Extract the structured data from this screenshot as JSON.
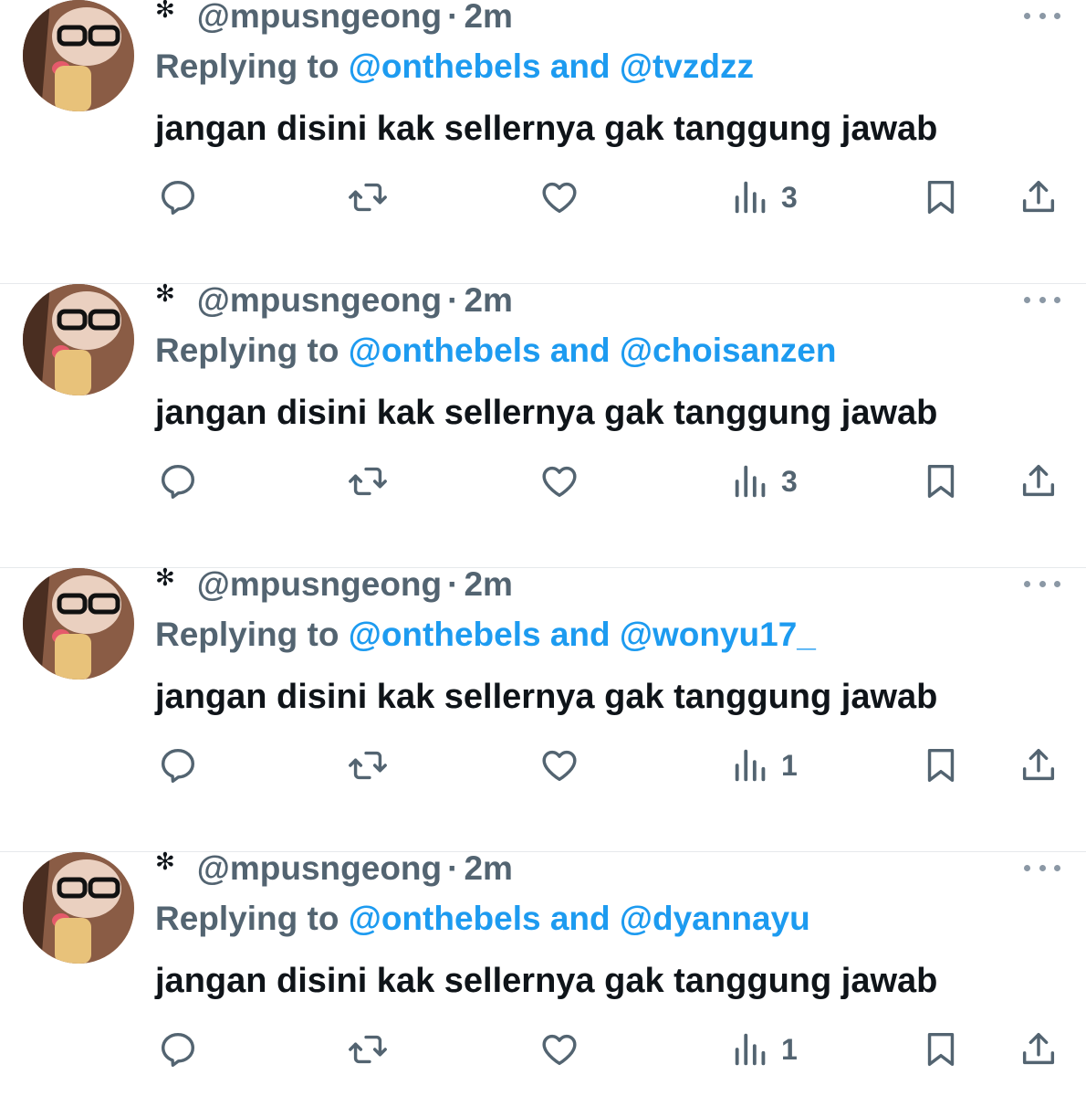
{
  "tweets": [
    {
      "handle": "@mpusngeong",
      "dot": "·",
      "time": "2m",
      "replying_prefix": "Replying to",
      "reply_user1": "@onthebels",
      "reply_and": "and",
      "reply_user2": "@tvzdzz",
      "text": "jangan disini kak sellernya gak tanggung jawab",
      "views": "3"
    },
    {
      "handle": "@mpusngeong",
      "dot": "·",
      "time": "2m",
      "replying_prefix": "Replying to",
      "reply_user1": "@onthebels",
      "reply_and": "and",
      "reply_user2": "@choisanzen",
      "text": "jangan disini kak sellernya gak tanggung jawab",
      "views": "3"
    },
    {
      "handle": "@mpusngeong",
      "dot": "·",
      "time": "2m",
      "replying_prefix": "Replying to",
      "reply_user1": "@onthebels",
      "reply_and": "and",
      "reply_user2": "@wonyu17_",
      "text": "jangan disini kak sellernya gak tanggung jawab",
      "views": "1"
    },
    {
      "handle": "@mpusngeong",
      "dot": "·",
      "time": "2m",
      "replying_prefix": "Replying to",
      "reply_user1": "@onthebels",
      "reply_and": "and",
      "reply_user2": "@dyannayu",
      "text": "jangan disini kak sellernya gak tanggung jawab",
      "views": "1"
    }
  ],
  "icons": {
    "name_mark": "✻",
    "reply": "reply-icon",
    "retweet": "retweet-icon",
    "like": "heart-icon",
    "views": "views-icon",
    "bookmark": "bookmark-icon",
    "share": "share-icon",
    "more": "more-icon"
  },
  "colors": {
    "text": "#0f1419",
    "secondary": "#536471",
    "link": "#1d9bf0",
    "divider": "#e6e9ec"
  }
}
